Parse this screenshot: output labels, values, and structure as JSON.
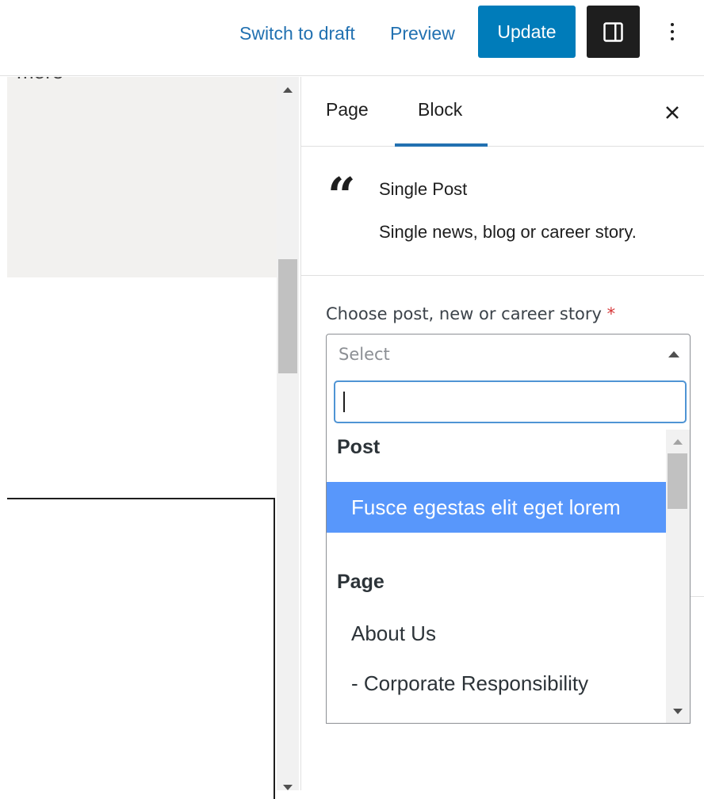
{
  "toolbar": {
    "switch_draft_label": "Switch to draft",
    "preview_label": "Preview",
    "update_label": "Update",
    "settings_icon": "sidebar-toggle-icon",
    "more_icon": "vertical-ellipsis-icon",
    "accent_color": "#007cba"
  },
  "canvas": {
    "partial_text": "more"
  },
  "sidebar": {
    "tabs": [
      {
        "label": "Page",
        "active": false
      },
      {
        "label": "Block",
        "active": true
      }
    ],
    "close_icon": "close-icon",
    "block": {
      "icon": "quote-icon",
      "title": "Single Post",
      "description": "Single news, blog or career story."
    },
    "field": {
      "label": "Choose post, new or career story",
      "required_marker": "*",
      "placeholder": "Select",
      "search_value": "",
      "groups": [
        {
          "label": "Post",
          "options": [
            {
              "label": "Fusce egestas elit eget lorem",
              "highlighted": true
            }
          ]
        },
        {
          "label": "Page",
          "options": [
            {
              "label": "About Us",
              "highlighted": false
            },
            {
              "label": "- Corporate Responsibility",
              "highlighted": false
            }
          ]
        }
      ],
      "highlight_color": "#5897fb"
    }
  }
}
